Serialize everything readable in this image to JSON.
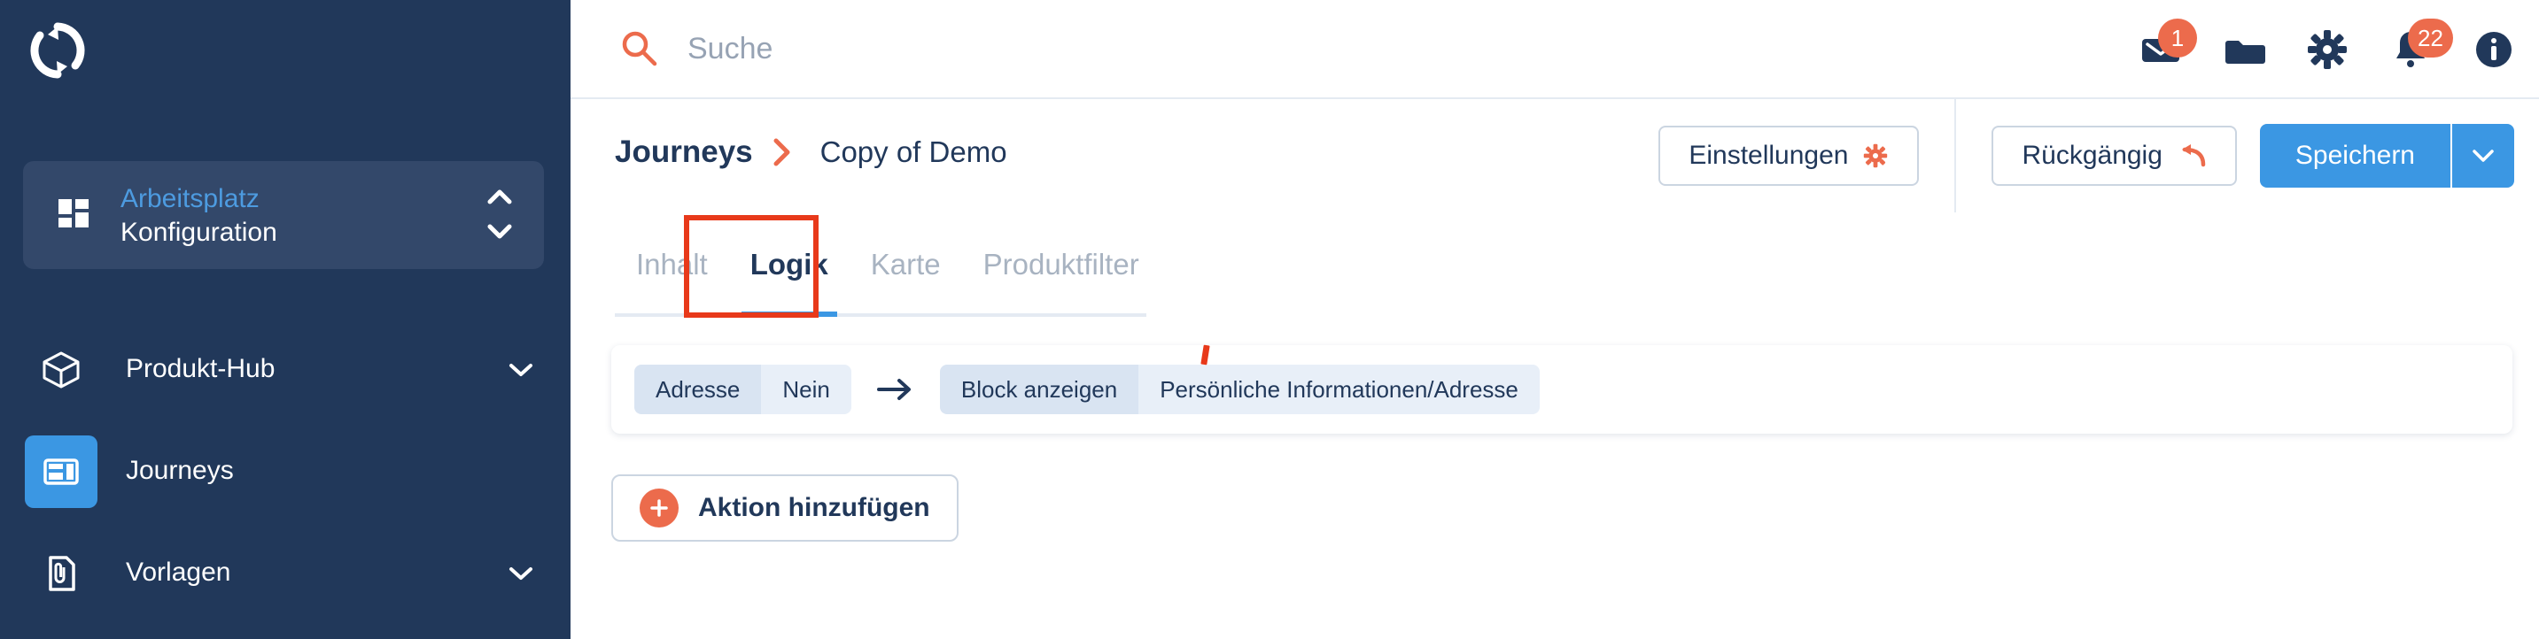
{
  "brand": {
    "logo_icon": "refresh-cycle-logo"
  },
  "sidebar": {
    "workspace": {
      "icon": "grid-dashboard-icon",
      "line1": "Arbeitsplatz",
      "line2": "Konfiguration",
      "chevron_up_icon": "chevron-up-icon",
      "chevron_down_icon": "chevron-down-icon",
      "line1_color": "#4D9BE0"
    },
    "items": [
      {
        "label": "Produkt-Hub",
        "icon": "cube-box-icon",
        "active": false,
        "has_chevron": true
      },
      {
        "label": "Journeys",
        "icon": "layout-panels-icon",
        "active": true,
        "has_chevron": false
      },
      {
        "label": "Vorlagen",
        "icon": "document-paperclip-icon",
        "active": false,
        "has_chevron": true
      }
    ],
    "background_color": "#21385A",
    "active_tile_color": "#3B97E3"
  },
  "topbar": {
    "search": {
      "icon": "search-icon",
      "placeholder": "Suche",
      "value": ""
    },
    "icons": [
      {
        "name": "mail-icon",
        "badge": "1"
      },
      {
        "name": "folder-icon",
        "badge": ""
      },
      {
        "name": "gear-icon",
        "badge": ""
      },
      {
        "name": "bell-icon",
        "badge": "22"
      },
      {
        "name": "info-icon",
        "badge": ""
      }
    ],
    "badge_color": "#EC6B4C"
  },
  "page_header": {
    "breadcrumb": {
      "root": "Journeys",
      "separator_icon": "chevron-right-icon",
      "current": "Copy of Demo"
    },
    "settings_button": {
      "label": "Einstellungen",
      "icon": "gear-icon"
    },
    "undo_button": {
      "label": "Rückgängig",
      "icon": "undo-arrow-icon"
    },
    "save_button": {
      "label": "Speichern",
      "caret_icon": "chevron-down-icon"
    },
    "save_color": "#3B97E3"
  },
  "tabs": {
    "items": [
      {
        "label": "Inhalt",
        "active": false
      },
      {
        "label": "Logik",
        "active": true
      },
      {
        "label": "Karte",
        "active": false
      },
      {
        "label": "Produktfilter",
        "active": false
      }
    ],
    "active_underline_color": "#3B97E3"
  },
  "main": {
    "rules": [
      {
        "condition": [
          {
            "text": "Adresse",
            "tone": "dark"
          },
          {
            "text": "Nein",
            "tone": "light"
          }
        ],
        "arrow_icon": "arrow-right-icon",
        "action": [
          {
            "text": "Block anzeigen",
            "tone": "dark"
          },
          {
            "text": "Persönliche Informationen/Adresse",
            "tone": "light"
          }
        ]
      }
    ],
    "add_action_button": {
      "label": "Aktion hinzufügen",
      "icon": "plus-circle-icon"
    }
  },
  "annotations": {
    "highlight_color": "#E8391A",
    "tab_highlight_target": "Logik",
    "tick_mark": true
  }
}
